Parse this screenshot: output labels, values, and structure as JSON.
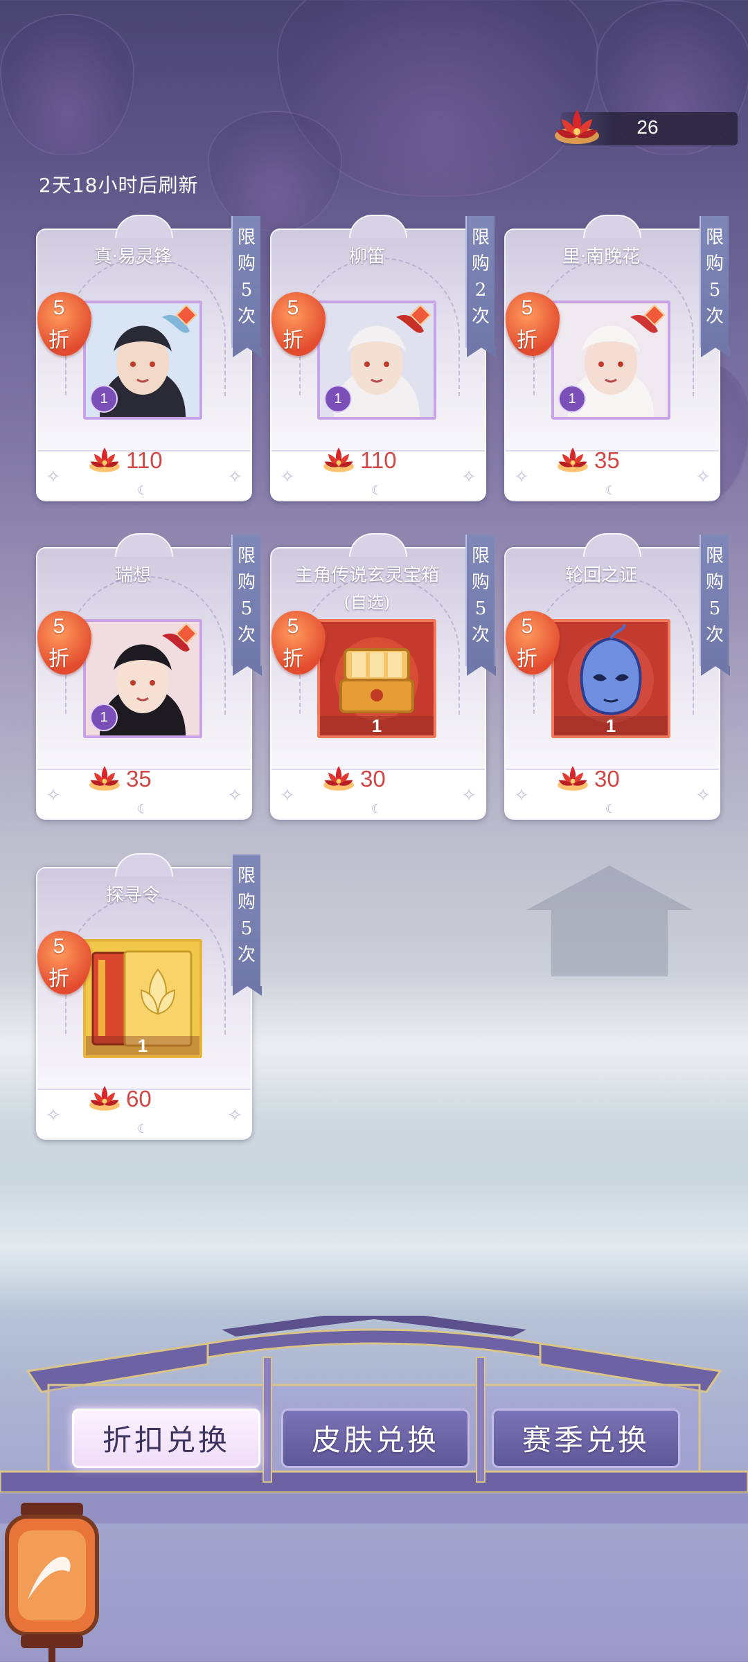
{
  "header": {
    "currency_value": "26",
    "refresh_text": "2天18小时后刷新"
  },
  "items": [
    {
      "name": "真·易灵锋",
      "sub": "",
      "limit": [
        "限",
        "购",
        "5",
        "次"
      ],
      "discount": [
        "5",
        "折"
      ],
      "price": "110",
      "kind": "character",
      "level": "1",
      "portrait": "portrait-1"
    },
    {
      "name": "柳笛",
      "sub": "",
      "limit": [
        "限",
        "购",
        "2",
        "次"
      ],
      "discount": [
        "5",
        "折"
      ],
      "price": "110",
      "kind": "character",
      "level": "1",
      "portrait": "portrait-2"
    },
    {
      "name": "里·南晚花",
      "sub": "",
      "limit": [
        "限",
        "购",
        "5",
        "次"
      ],
      "discount": [
        "5",
        "折"
      ],
      "price": "35",
      "kind": "character",
      "level": "1",
      "portrait": "portrait-3"
    },
    {
      "name": "瑞想",
      "sub": "",
      "limit": [
        "限",
        "购",
        "5",
        "次"
      ],
      "discount": [
        "5",
        "折"
      ],
      "price": "35",
      "kind": "character",
      "level": "1",
      "portrait": "portrait-4"
    },
    {
      "name": "主角传说玄灵宝箱",
      "sub": "(自选)",
      "limit": [
        "限",
        "购",
        "5",
        "次"
      ],
      "discount": [
        "5",
        "折"
      ],
      "price": "30",
      "kind": "chest",
      "count": "1"
    },
    {
      "name": "轮回之证",
      "sub": "",
      "limit": [
        "限",
        "购",
        "5",
        "次"
      ],
      "discount": [
        "5",
        "折"
      ],
      "price": "30",
      "kind": "mask",
      "count": "1"
    },
    {
      "name": "探寻令",
      "sub": "",
      "limit": [
        "限",
        "购",
        "5",
        "次"
      ],
      "discount": [
        "5",
        "折"
      ],
      "price": "60",
      "kind": "token",
      "count": "1"
    }
  ],
  "tabs": [
    {
      "label": "折扣兑换",
      "active": true
    },
    {
      "label": "皮肤兑换",
      "active": false
    },
    {
      "label": "赛季兑换",
      "active": false
    }
  ],
  "colors": {
    "price_red": "#d24646",
    "discount_orange": "#e24b2e",
    "limit_ribbon": "#7f88b8",
    "tab_purple": "#6a64a8"
  },
  "icons": {
    "currency": "red-lotus-icon",
    "price": "red-lotus-icon",
    "corner": "lantern-event-icon"
  }
}
